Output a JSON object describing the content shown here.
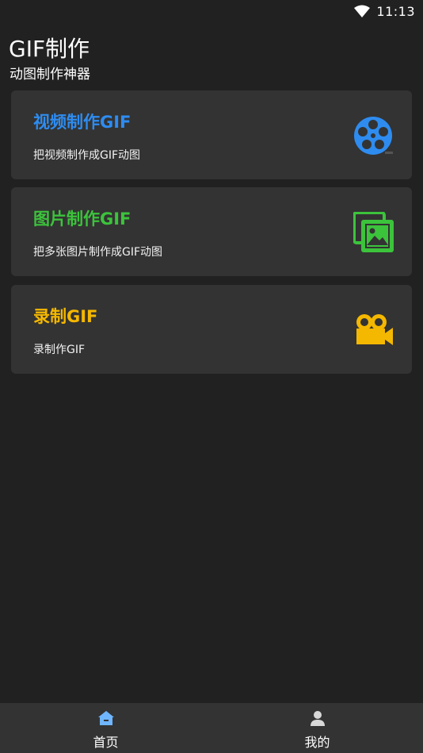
{
  "status_bar": {
    "time": "11:13",
    "wifi_icon": "wifi-icon"
  },
  "header": {
    "title": "GIF制作",
    "subtitle": "动图制作神器"
  },
  "cards": [
    {
      "title": "视频制作GIF",
      "description": "把视频制作成GIF动图",
      "icon": "film-reel-icon",
      "color": "#2e8cf0"
    },
    {
      "title": "图片制作GIF",
      "description": "把多张图片制作成GIF动图",
      "icon": "image-gallery-icon",
      "color": "#3cc33c"
    },
    {
      "title": "录制GIF",
      "description": "录制作GIF",
      "icon": "video-camera-icon",
      "color": "#f5b800"
    }
  ],
  "bottom_nav": [
    {
      "label": "首页",
      "icon": "home-icon",
      "active": true,
      "color": "#6fb6ff"
    },
    {
      "label": "我的",
      "icon": "user-icon",
      "active": false,
      "color": "#d8d8d8"
    }
  ],
  "colors": {
    "background": "#212121",
    "card": "#333333",
    "nav": "#333333"
  }
}
